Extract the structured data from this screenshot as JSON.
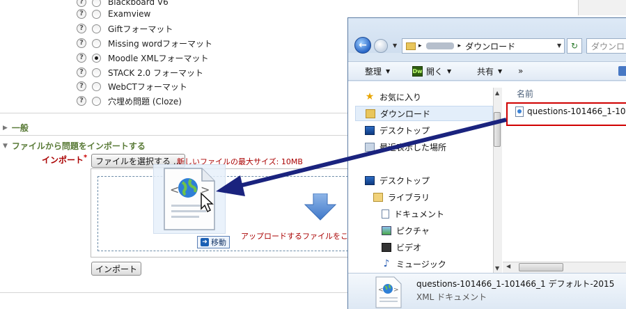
{
  "formats": [
    {
      "label": "Blackboard V6",
      "checked": false
    },
    {
      "label": "Examview",
      "checked": false
    },
    {
      "label": "Giftフォーマット",
      "checked": false
    },
    {
      "label": "Missing wordフォーマット",
      "checked": false
    },
    {
      "label": "Moodle XMLフォーマット",
      "checked": true
    },
    {
      "label": "STACK 2.0 フォーマット",
      "checked": false
    },
    {
      "label": "WebCTフォーマット",
      "checked": false
    },
    {
      "label": "穴埋め問題 (Cloze)",
      "checked": false
    }
  ],
  "sections": {
    "general": "一般",
    "import_from_file": "ファイルから問題をインポートする"
  },
  "import_form": {
    "label": "インポート",
    "required_mark": "*",
    "choose_file_button": "ファイルを選択する ...",
    "max_size_text": "新しいファイルの最大サイズ: 10MB",
    "drop_text": "アップロードするファイルをここ",
    "import_button": "インポート",
    "move_badge": "移動"
  },
  "explorer": {
    "address_tail": "ダウンロード",
    "search_placeholder": "ダウンロ",
    "toolbar": {
      "organize": "整理",
      "open": "開く",
      "dw_icon": "Dw",
      "share": "共有",
      "more": "»"
    },
    "nav": {
      "favorites": "お気に入り",
      "downloads": "ダウンロード",
      "desktop": "デスクトップ",
      "recent": "最近表示した場所",
      "desktop2": "デスクトップ",
      "libraries": "ライブラリ",
      "documents": "ドキュメント",
      "pictures": "ピクチャ",
      "videos": "ビデオ",
      "music": "ミュージック"
    },
    "column_name": "名前",
    "file_name": "questions-101466_1-10",
    "details_name": "questions-101466_1-101466_1 デフォルト-2015",
    "details_type": "XML ドキュメント"
  },
  "colors": {
    "arrow": "#1a237e",
    "highlight": "#d00000",
    "required": "#aa0000"
  }
}
